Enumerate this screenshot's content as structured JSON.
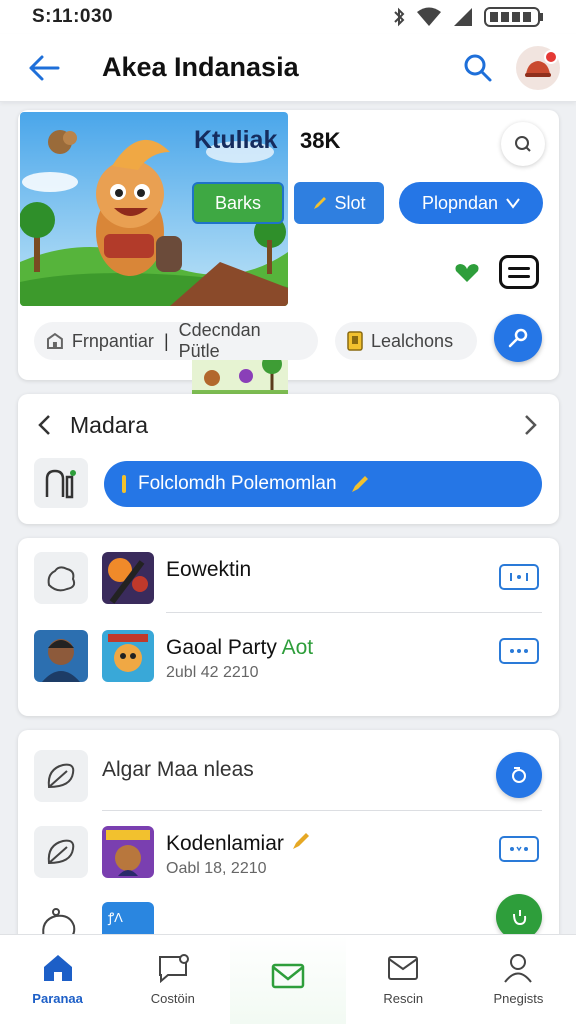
{
  "status_bar": {
    "time": "S:11:030"
  },
  "app_bar": {
    "title": "Akea Indanasia"
  },
  "hero": {
    "title": "Ktuliak",
    "count": "38K",
    "buttons": {
      "green": "Barks",
      "blue": "Slot",
      "pill": "Plopndan"
    },
    "tags": {
      "left_a": "Frnpantiar",
      "separator": "|",
      "left_b": "Cdecndan Pütle",
      "right": "Lealchons"
    }
  },
  "section": {
    "title": "Madara",
    "button_label": "Folclomdh Polemomlan"
  },
  "list1": {
    "rows": [
      {
        "title": "Eowektin"
      },
      {
        "title": "Gaoal Party",
        "title_accent": "Aot",
        "subtitle": "2ubl 42 2210"
      }
    ]
  },
  "list2": {
    "rows": [
      {
        "title": "Algar Maa nleas"
      },
      {
        "title": "Kodenlamiar",
        "subtitle": "Oabl 18, 2210"
      },
      {
        "badge": "ꝭΛ"
      }
    ]
  },
  "bottom_nav": {
    "items": [
      {
        "label": "Paranaa",
        "icon": "home-icon",
        "active": true
      },
      {
        "label": "Costöin",
        "icon": "chat-icon"
      },
      {
        "label": "",
        "icon": "mail-icon"
      },
      {
        "label": "Rescin",
        "icon": "inbox-icon"
      },
      {
        "label": "Pnegists",
        "icon": "person-icon"
      }
    ]
  },
  "colors": {
    "primary": "#2576e6",
    "green": "#3ea843",
    "accent_red": "#e53935"
  }
}
